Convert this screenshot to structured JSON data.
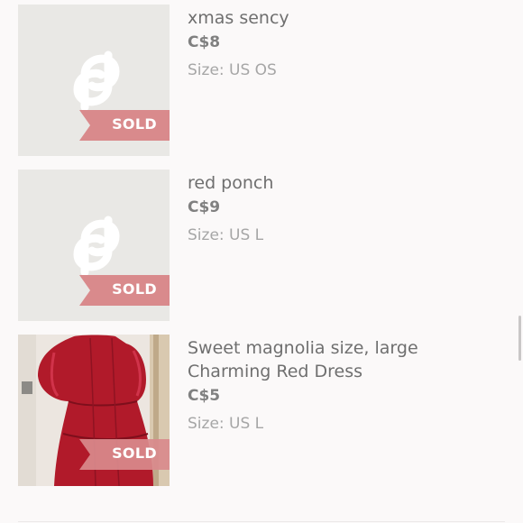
{
  "colors": {
    "background": "#fbf9f9",
    "placeholder_bg": "#e9e8e5",
    "sold_ribbon": "#d98a8c",
    "title_text": "#6f6f6f",
    "price_text": "#808080",
    "size_text": "#a6a6a6"
  },
  "listings": [
    {
      "title": "xmas sency",
      "price": "C$8",
      "size": "Size: US OS",
      "sold_label": "SOLD",
      "image": "placeholder-logo"
    },
    {
      "title": "red ponch",
      "price": "C$9",
      "size": "Size: US L",
      "sold_label": "SOLD",
      "image": "placeholder-logo"
    },
    {
      "title_line1": "Sweet magnolia size, large",
      "title_line2": "Charming Red Dress",
      "price": "C$5",
      "size": "Size: US L",
      "sold_label": "SOLD",
      "image": "red-dress-photo"
    }
  ]
}
